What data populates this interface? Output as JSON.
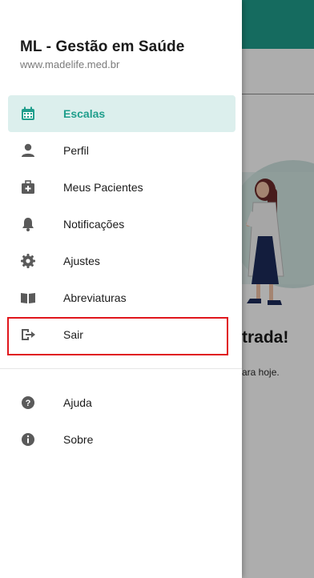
{
  "background": {
    "heading_partial": "trada!",
    "sub_partial": "ara hoje.",
    "colors": {
      "topbar": "#1f9e8c"
    }
  },
  "drawer": {
    "title": "ML - Gestão em Saúde",
    "url": "www.madelife.med.br",
    "items": [
      {
        "label": "Escalas",
        "icon": "calendar-icon",
        "active": true
      },
      {
        "label": "Perfil",
        "icon": "person-icon"
      },
      {
        "label": "Meus Pacientes",
        "icon": "medical-kit-icon"
      },
      {
        "label": "Notificações",
        "icon": "bell-icon"
      },
      {
        "label": "Ajustes",
        "icon": "gear-icon"
      },
      {
        "label": "Abreviaturas",
        "icon": "book-icon"
      },
      {
        "label": "Sair",
        "icon": "logout-icon",
        "highlighted": true
      }
    ],
    "secondary_items": [
      {
        "label": "Ajuda",
        "icon": "help-icon"
      },
      {
        "label": "Sobre",
        "icon": "info-icon"
      }
    ],
    "colors": {
      "accent": "#1f9e8c",
      "active_bg": "#dcefed",
      "icon": "#5a5a5a",
      "highlight": "#e0161c"
    }
  }
}
